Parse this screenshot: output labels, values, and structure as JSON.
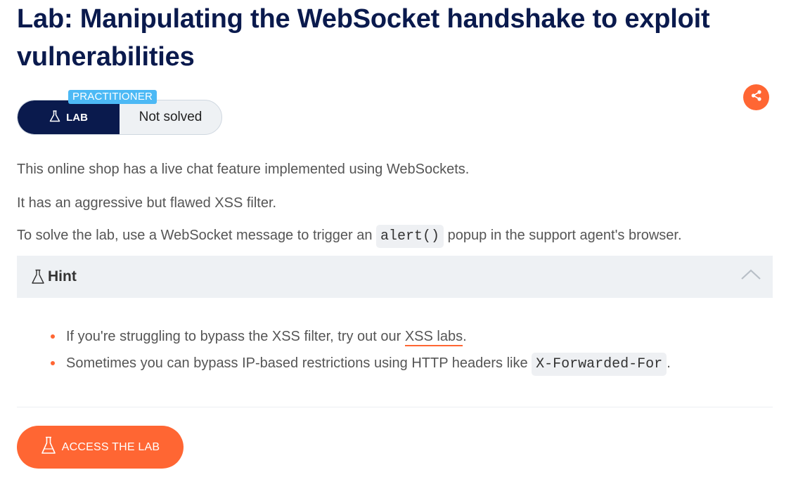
{
  "lab": {
    "title": "Lab: Manipulating the WebSocket handshake to exploit vulnerabilities",
    "level": "PRACTITIONER",
    "badge_label": "LAB",
    "status": "Not solved"
  },
  "description": {
    "p1": "This online shop has a live chat feature implemented using WebSockets.",
    "p2": "It has an aggressive but flawed XSS filter.",
    "p3_before": "To solve the lab, use a WebSocket message to trigger an",
    "p3_code": "alert()",
    "p3_after": "popup in the support agent's browser."
  },
  "hint": {
    "label": "Hint",
    "items": [
      {
        "before": "If you're struggling to bypass the XSS filter, try out our",
        "link": "XSS labs",
        "after": "."
      },
      {
        "before": "Sometimes you can bypass IP-based restrictions using HTTP headers like",
        "code": "X-Forwarded-For",
        "after": "."
      }
    ]
  },
  "actions": {
    "access_lab": "ACCESS THE LAB"
  },
  "icons": {
    "flask": "flask-icon",
    "share": "share-icon",
    "chevron": "chevron-up-icon"
  },
  "colors": {
    "title": "#0a1a4d",
    "accent": "#ff6633",
    "level": "#4cb9f5",
    "badge_dark": "#0a1a4d"
  }
}
